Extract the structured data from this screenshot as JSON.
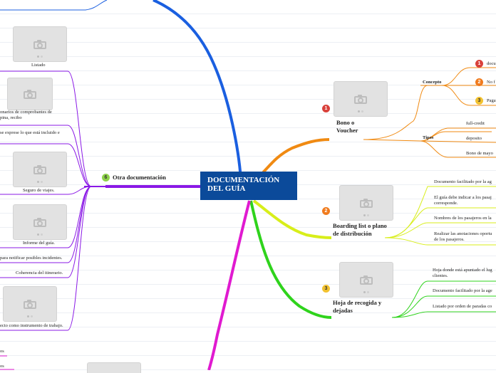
{
  "central": {
    "title_line1": "DOCUMENTACIÓN",
    "title_line2": "DEL GUÍA"
  },
  "branches": {
    "bono": {
      "number": "1",
      "label_line1": "Bono o",
      "label_line2": "Voucher"
    },
    "boarding": {
      "number": "2",
      "label_line1": "Boarding list o plano",
      "label_line2": "de distribución"
    },
    "hoja": {
      "number": "3",
      "label_line1": "Hoja de recogida y",
      "label_line2": "dejadas"
    },
    "otra": {
      "number": "6",
      "label": "Otra documentación"
    }
  },
  "bono_children": {
    "concepto": "Concepto",
    "tipos": "Tipos",
    "concepto_items": [
      {
        "number": "1",
        "text": "docu"
      },
      {
        "number": "2",
        "text": "No f"
      },
      {
        "number": "3",
        "text": "Paga"
      }
    ],
    "tipos_items": [
      "full-credit",
      "deposito",
      "Bono de mayo"
    ]
  },
  "boarding_children": [
    [
      "Documento facilitado por la ag"
    ],
    [
      "El guía debe indicar a los pasaj",
      "corresponde."
    ],
    [
      "Nombres de los pasajeros en la"
    ],
    [
      "Realizar las anotaciones oportu",
      "de los pasajeros."
    ]
  ],
  "hoja_children": [
    [
      "Hoja donde está apuntado el lug",
      "clientes."
    ],
    [
      "Documento facilitado por la age"
    ],
    [
      "Listado por orden de paradas co"
    ]
  ],
  "otra_children": {
    "listado": "Listado",
    "comprobantes_line1": "onarios de comprobantes de",
    "comprobantes_line2": "pina, recibo",
    "exprese": "se exprese lo que está incluido e",
    "seguro": "Seguro de viajes.",
    "informe": "Informe del guía.",
    "notificar": "para notificar posibles incidentes.",
    "coherencia": "Coherencia del itinerario.",
    "instrumento": "ecto como instrumento de trabajo."
  },
  "bottom_left": [
    "os",
    "os"
  ],
  "colors": {
    "central_bg": "#0b4a9a",
    "blue_branch": "#1a5fe0",
    "orange_branch": "#f08a12",
    "yellow_branch": "#d8ee1a",
    "green_branch": "#2fd31c",
    "purple_branch": "#8a18e6",
    "magenta_branch": "#e01ad0"
  },
  "icons": [
    "camera-icon"
  ]
}
